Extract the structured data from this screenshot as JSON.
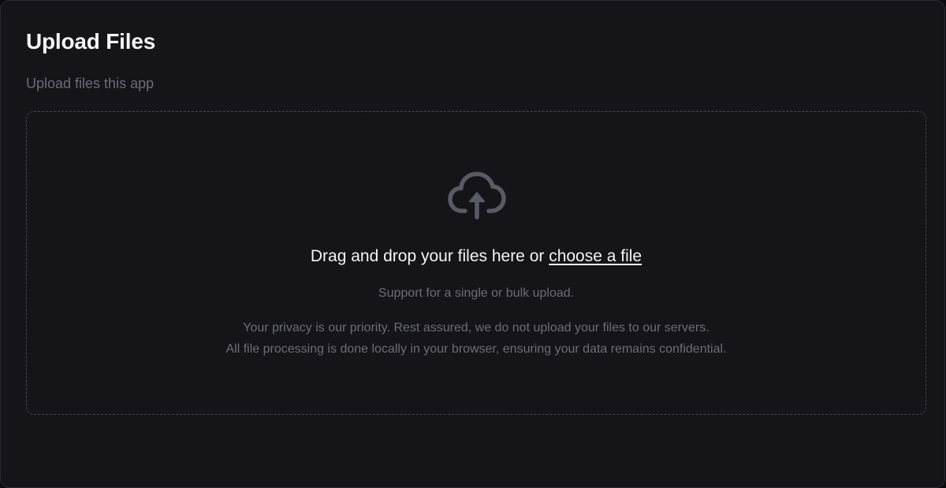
{
  "header": {
    "title": "Upload Files",
    "subtitle": "Upload files this app"
  },
  "dropzone": {
    "icon": "cloud-upload-icon",
    "drag_text": "Drag and drop your files here or ",
    "choose_link": "choose a file",
    "support_text": "Support for a single or bulk upload.",
    "privacy_line_1": "Your privacy is our priority. Rest assured, we do not upload your files to our servers.",
    "privacy_line_2": "All file processing is done locally in your browser, ensuring your data remains confidential."
  },
  "colors": {
    "background": "#141419",
    "title": "#f4f4f6",
    "muted_text": "#6c6c78",
    "dashed_border": "#464652",
    "icon": "#5a5a66"
  }
}
